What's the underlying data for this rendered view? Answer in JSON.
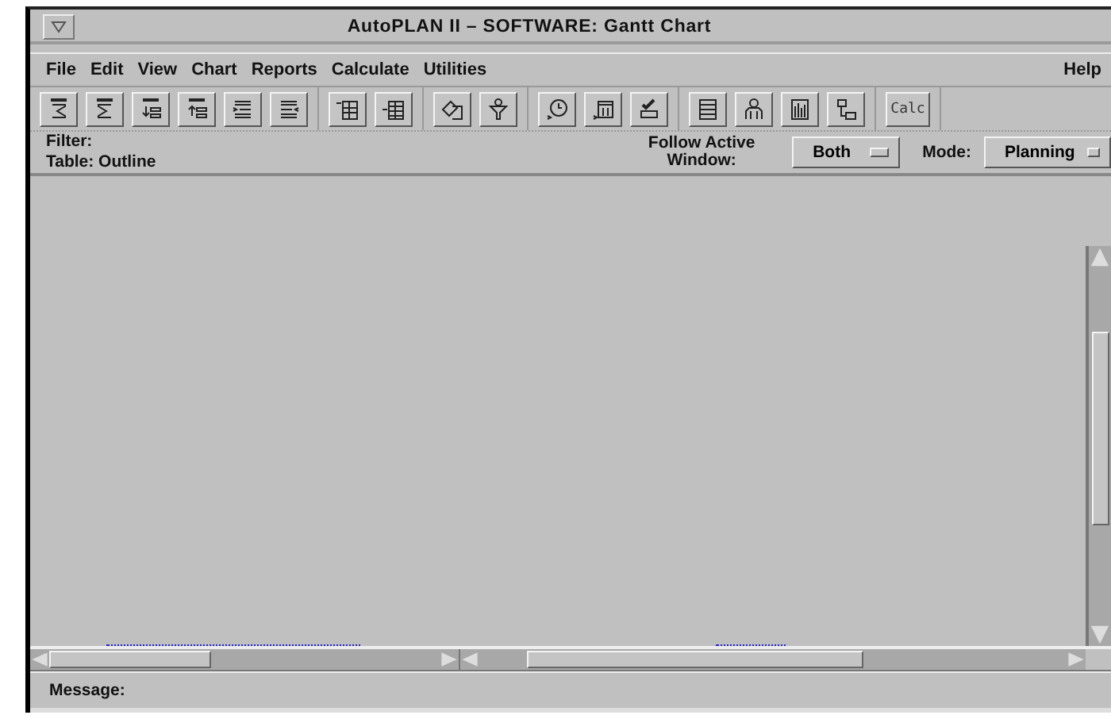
{
  "window": {
    "title": "AutoPLAN II – SOFTWARE: Gantt Chart"
  },
  "menu": [
    {
      "label": "File"
    },
    {
      "label": "Edit"
    },
    {
      "label": "View"
    },
    {
      "label": "Chart"
    },
    {
      "label": "Reports"
    },
    {
      "label": "Calculate"
    },
    {
      "label": "Utilities"
    }
  ],
  "help_menu": {
    "label": "Help"
  },
  "toolbar": {
    "text_button": {
      "label": "Calc"
    }
  },
  "filter_label": "Filter:",
  "table_label": "Table: Outline",
  "follow_label": "Follow Active Window:",
  "follow_option": {
    "value": "Both"
  },
  "mode_label": "Mode:",
  "mode_option": {
    "value": "Planning"
  },
  "status_bar": {
    "label": "Message:"
  }
}
